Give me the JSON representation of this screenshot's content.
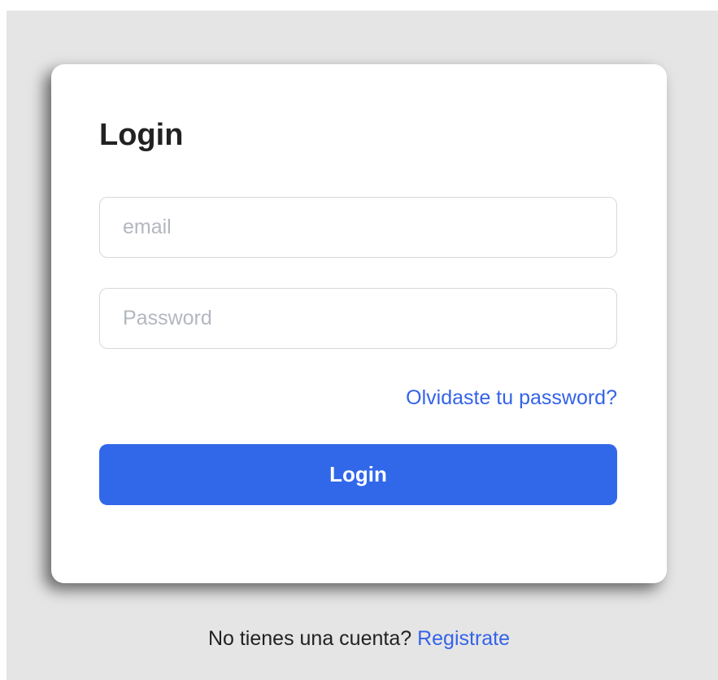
{
  "login_card": {
    "title": "Login",
    "email_placeholder": "email",
    "password_placeholder": "Password",
    "forgot_link": "Olvidaste tu password?",
    "submit_label": "Login"
  },
  "footer": {
    "prompt": "No tienes una cuenta?",
    "register_link": "Registrate"
  },
  "colors": {
    "background": "#e5e5e5",
    "card": "#ffffff",
    "primary": "#3168ea",
    "link": "#3463e8"
  }
}
